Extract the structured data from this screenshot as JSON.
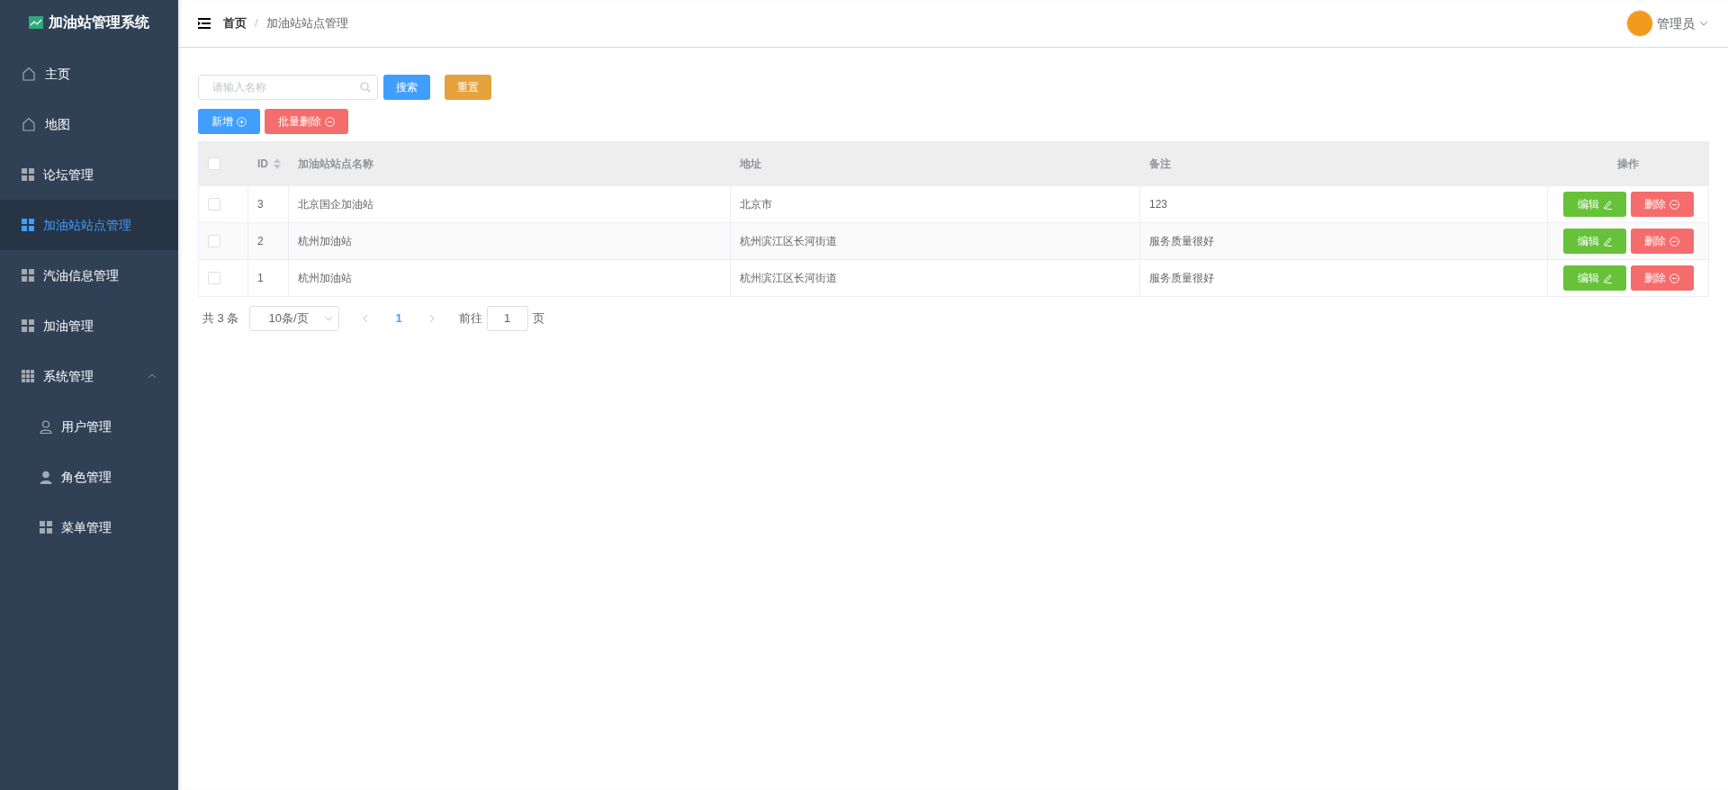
{
  "sidebar": {
    "title": "加油站管理系统",
    "items": [
      {
        "label": "主页",
        "selected": false
      },
      {
        "label": "地图",
        "selected": false
      },
      {
        "label": "论坛管理",
        "selected": false
      },
      {
        "label": "加油站站点管理",
        "selected": true
      },
      {
        "label": "汽油信息管理",
        "selected": false
      },
      {
        "label": "加油管理",
        "selected": false
      },
      {
        "label": "系统管理",
        "selected": false,
        "expanded": true,
        "children": [
          {
            "label": "用户管理",
            "selected": false
          },
          {
            "label": "角色管理",
            "selected": false
          },
          {
            "label": "菜单管理",
            "selected": false
          }
        ]
      }
    ]
  },
  "header": {
    "breadcrumb": [
      "首页",
      "加油站站点管理"
    ],
    "separator": "/",
    "user": "管理员"
  },
  "toolbar": {
    "search": {
      "placeholder": "请输入名称"
    },
    "search_button": "搜索",
    "reset_button": "重置",
    "add_button": "新增",
    "batch_delete_button": "批量删除"
  },
  "table": {
    "select_all": false,
    "columns": [
      "ID",
      "加油站站点名称",
      "地址",
      "备注",
      "操作"
    ],
    "rows": [
      {
        "checked": false,
        "cells": [
          "3",
          "北京国企加油站",
          "北京市",
          "123"
        ],
        "edit": "编辑",
        "delete": "删除"
      },
      {
        "checked": false,
        "cells": [
          "2",
          "杭州加油站",
          "杭州滨江区长河街道",
          "服务质量很好"
        ],
        "edit": "编辑",
        "delete": "删除"
      },
      {
        "checked": false,
        "cells": [
          "1",
          "杭州加油站",
          "杭州滨江区长河街道",
          "服务质量很好"
        ],
        "edit": "编辑",
        "delete": "删除"
      }
    ]
  },
  "pagination": {
    "total": "共 3 条",
    "page_size": "10条/页",
    "pages": [
      {
        "label": "1",
        "selected": true
      }
    ],
    "goto_label": "前往",
    "goto_value": "1",
    "goto_suffix": "页"
  }
}
